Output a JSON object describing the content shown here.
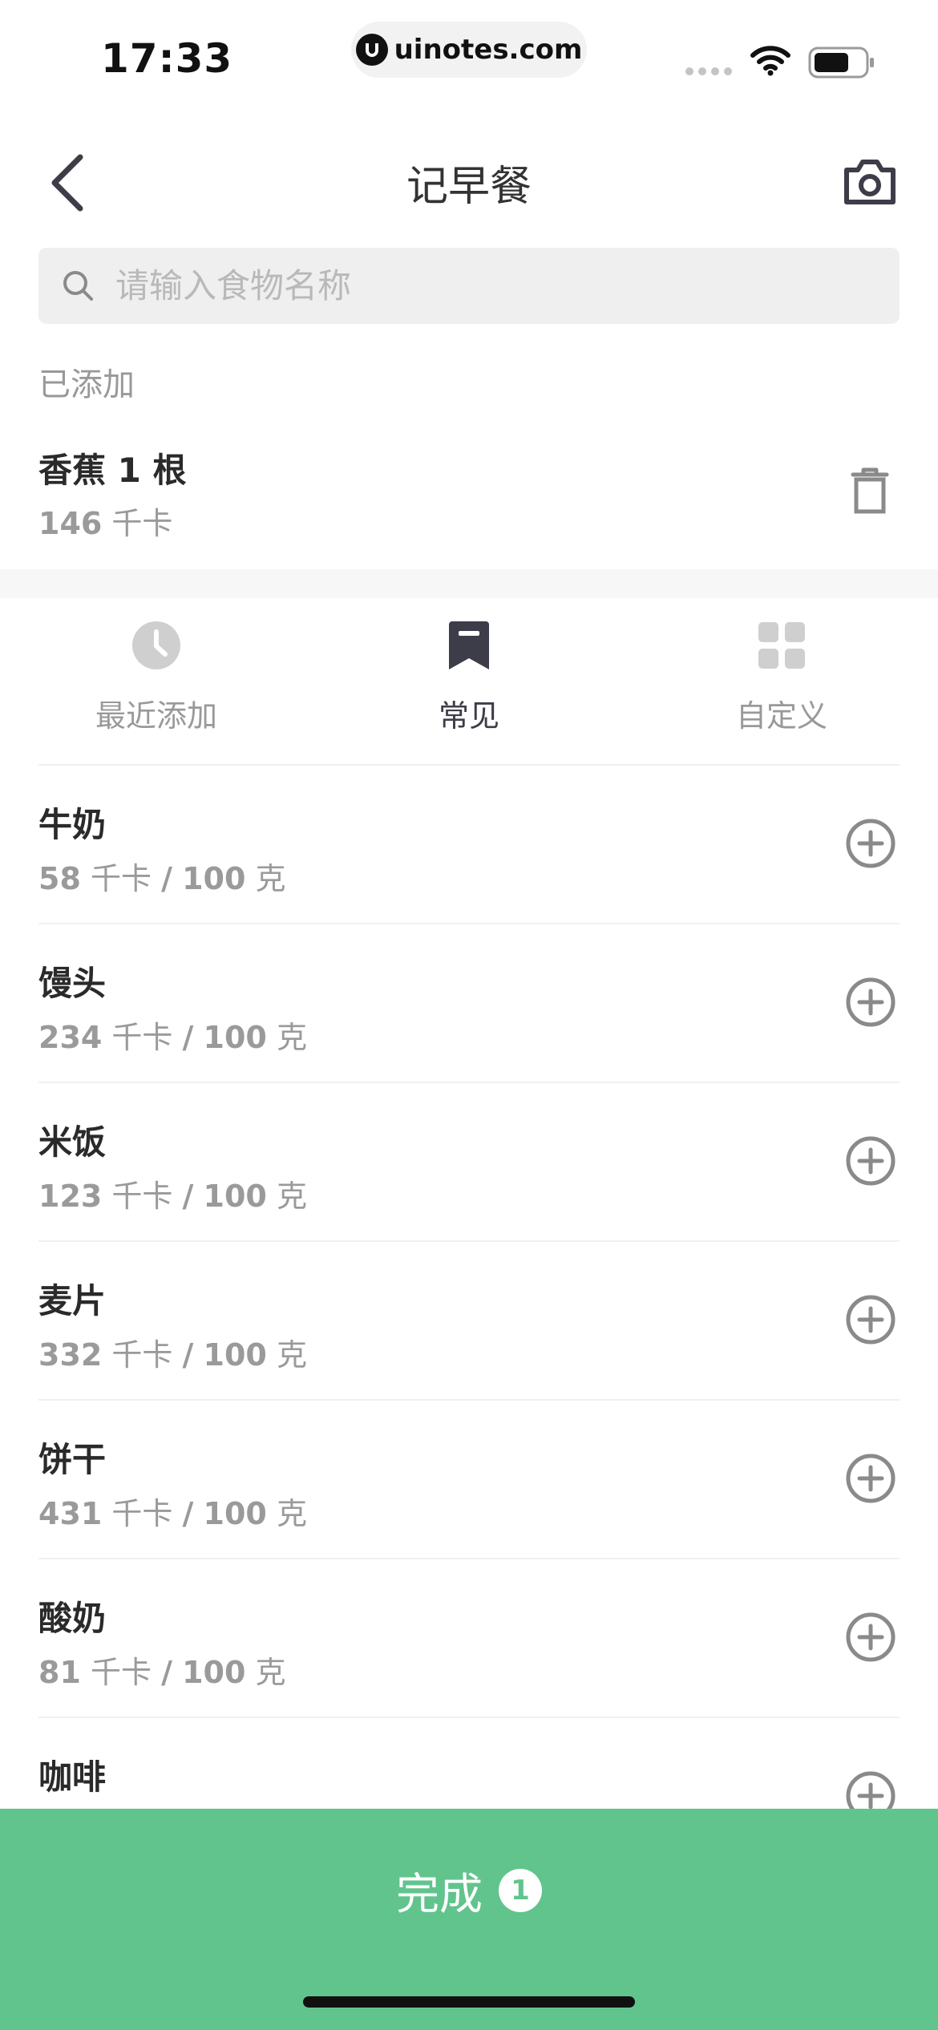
{
  "status_bar": {
    "time": "17:33",
    "url": "uinotes.com"
  },
  "nav": {
    "title": "记早餐"
  },
  "search": {
    "placeholder": "请输入食物名称",
    "value": ""
  },
  "added": {
    "section_label": "已添加",
    "item": {
      "name": "香蕉 1 根",
      "kcal_value": "146",
      "kcal_unit": "千卡"
    }
  },
  "tabs": [
    {
      "label": "最近添加",
      "icon": "clock-icon",
      "active": false
    },
    {
      "label": "常见",
      "icon": "bookmark-icon",
      "active": true
    },
    {
      "label": "自定义",
      "icon": "grid-icon",
      "active": false
    }
  ],
  "foods": [
    {
      "name": "牛奶",
      "kcal": "58",
      "unit": "千卡",
      "per": "100",
      "per_unit": "克"
    },
    {
      "name": "馒头",
      "kcal": "234",
      "unit": "千卡",
      "per": "100",
      "per_unit": "克"
    },
    {
      "name": "米饭",
      "kcal": "123",
      "unit": "千卡",
      "per": "100",
      "per_unit": "克"
    },
    {
      "name": "麦片",
      "kcal": "332",
      "unit": "千卡",
      "per": "100",
      "per_unit": "克"
    },
    {
      "name": "饼干",
      "kcal": "431",
      "unit": "千卡",
      "per": "100",
      "per_unit": "克"
    },
    {
      "name": "酸奶",
      "kcal": "81",
      "unit": "千卡",
      "per": "100",
      "per_unit": "克"
    },
    {
      "name": "咖啡",
      "kcal": "",
      "unit": "",
      "per": "",
      "per_unit": ""
    }
  ],
  "done": {
    "label": "完成",
    "count": "1"
  },
  "colors": {
    "accent": "#61c48c",
    "icon_gray": "#8a8a8a",
    "active_icon": "#3d3d4a"
  }
}
